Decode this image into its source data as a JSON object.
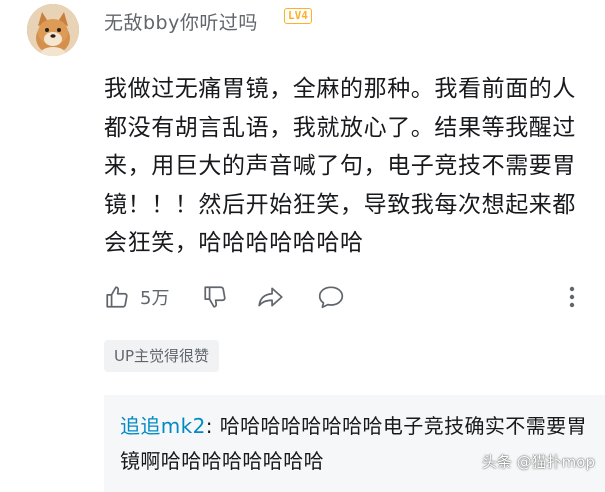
{
  "comment": {
    "username": "无敌bby你听过吗",
    "level_badge": "LV4",
    "text": "我做过无痛胃镜，全麻的那种。我看前面的人都没有胡言乱语，我就放心了。结果等我醒过来，用巨大的声音喊了句，电子竞技不需要胃镜！！！然后开始狂笑，导致我每次想起来都会狂笑，哈哈哈哈哈哈哈",
    "like_count": "5万",
    "up_tag": "UP主觉得很赞"
  },
  "reply": {
    "username": "追追mk2",
    "separator": ": ",
    "text": "哈哈哈哈哈哈哈哈电子竞技确实不需要胃镜啊哈哈哈哈哈哈哈哈"
  },
  "watermark": "头条 @猫扑mop",
  "icons": {
    "like": "thumbs-up-icon",
    "dislike": "thumbs-down-icon",
    "share": "share-icon",
    "reply": "comment-icon",
    "more": "more-vertical-icon"
  },
  "colors": {
    "username": "#61666d",
    "reply_username": "#008ac5",
    "level_badge": "#ffb027",
    "text": "#18191c",
    "tag_bg": "#f1f2f3",
    "reply_bg": "#f6f7f8"
  }
}
